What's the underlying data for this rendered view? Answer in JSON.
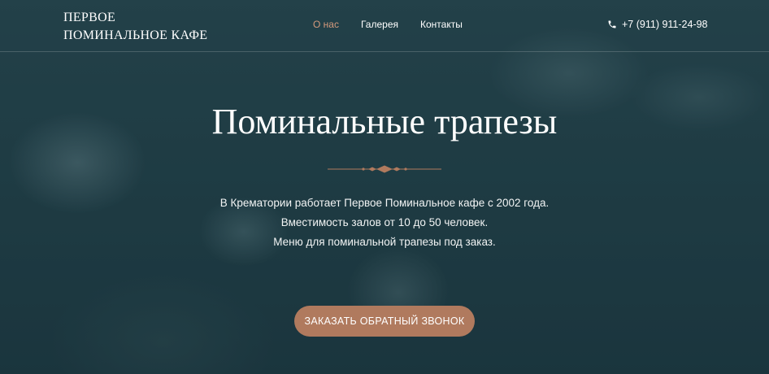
{
  "header": {
    "logo_line1": "ПЕРВОЕ",
    "logo_line2": "ПОМИНАЛЬНОЕ КАФЕ",
    "nav": [
      {
        "label": "О нас",
        "active": true
      },
      {
        "label": "Галерея",
        "active": false
      },
      {
        "label": "Контакты",
        "active": false
      }
    ],
    "phone": "+7 (911) 911-24-98",
    "phone_icon": "phone-icon"
  },
  "hero": {
    "title": "Поминальные трапезы",
    "lines": [
      "В Крематории работает Первое Поминальное кафе с 2002 года.",
      "Вместимость залов от 10 до 50 человек.",
      "Меню для поминальной трапезы под заказ."
    ],
    "cta_label": "ЗАКАЗАТЬ ОБРАТНЫЙ ЗВОНОК"
  },
  "colors": {
    "accent": "#b07a5e",
    "nav_active": "#d49a7c",
    "overlay": "#1f3a42"
  }
}
